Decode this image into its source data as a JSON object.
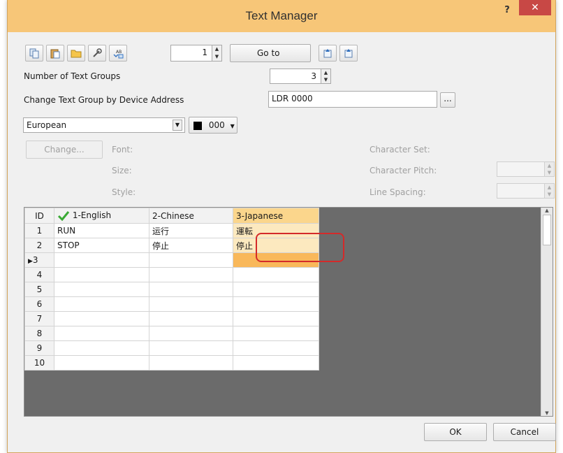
{
  "window": {
    "title": "Text Manager",
    "help": "?",
    "close": "✕"
  },
  "toolbar": {
    "row_number": "1",
    "goto_label": "Go to"
  },
  "settings": {
    "num_groups_label": "Number of Text Groups",
    "num_groups_value": "3",
    "device_addr_label": "Change Text Group by Device Address",
    "device_addr_value": "LDR 0000",
    "browse_label": "...",
    "language": "European",
    "color_value": "000"
  },
  "font": {
    "change_btn": "Change...",
    "font_label": "Font:",
    "size_label": "Size:",
    "style_label": "Style:",
    "charset_label": "Character Set:",
    "pitch_label": "Character Pitch:",
    "spacing_label": "Line Spacing:"
  },
  "grid": {
    "headers": {
      "id": "ID",
      "c1": "1-English",
      "c2": "2-Chinese",
      "c3": "3-Japanese"
    },
    "rows": [
      {
        "id": "1",
        "c1": "RUN",
        "c2": "运行",
        "c3": "運転"
      },
      {
        "id": "2",
        "c1": "STOP",
        "c2": "停止",
        "c3": "停止"
      },
      {
        "id": "3",
        "c1": "",
        "c2": "",
        "c3": ""
      },
      {
        "id": "4",
        "c1": "",
        "c2": "",
        "c3": ""
      },
      {
        "id": "5",
        "c1": "",
        "c2": "",
        "c3": ""
      },
      {
        "id": "6",
        "c1": "",
        "c2": "",
        "c3": ""
      },
      {
        "id": "7",
        "c1": "",
        "c2": "",
        "c3": ""
      },
      {
        "id": "8",
        "c1": "",
        "c2": "",
        "c3": ""
      },
      {
        "id": "9",
        "c1": "",
        "c2": "",
        "c3": ""
      },
      {
        "id": "10",
        "c1": "",
        "c2": "",
        "c3": ""
      }
    ],
    "current_marker": "▶"
  },
  "footer": {
    "ok": "OK",
    "cancel": "Cancel"
  },
  "colors": {
    "title_bar": "#f7c678",
    "close_red": "#c84845",
    "selected_column": "#fbd68c",
    "highlight_box": "#d42a2a"
  }
}
